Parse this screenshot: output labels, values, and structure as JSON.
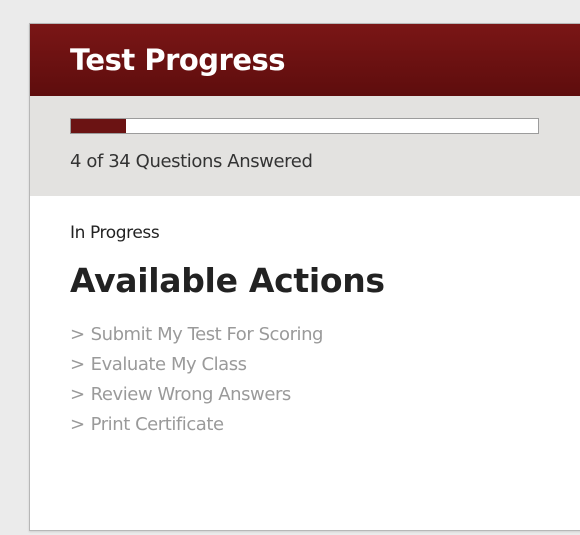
{
  "panel": {
    "title": "Test Progress",
    "accent_color": "#6b1313"
  },
  "progress": {
    "answered": 4,
    "total": 34,
    "fraction": 0.1176,
    "label": "4 of 34 Questions Answered"
  },
  "status": {
    "text": "In Progress"
  },
  "actions": {
    "heading": "Available Actions",
    "items": [
      {
        "marker": ">",
        "label": "Submit My Test For Scoring"
      },
      {
        "marker": ">",
        "label": "Evaluate My Class"
      },
      {
        "marker": ">",
        "label": "Review Wrong Answers"
      },
      {
        "marker": ">",
        "label": "Print Certificate"
      }
    ],
    "link_color": "#9a9a9a"
  }
}
